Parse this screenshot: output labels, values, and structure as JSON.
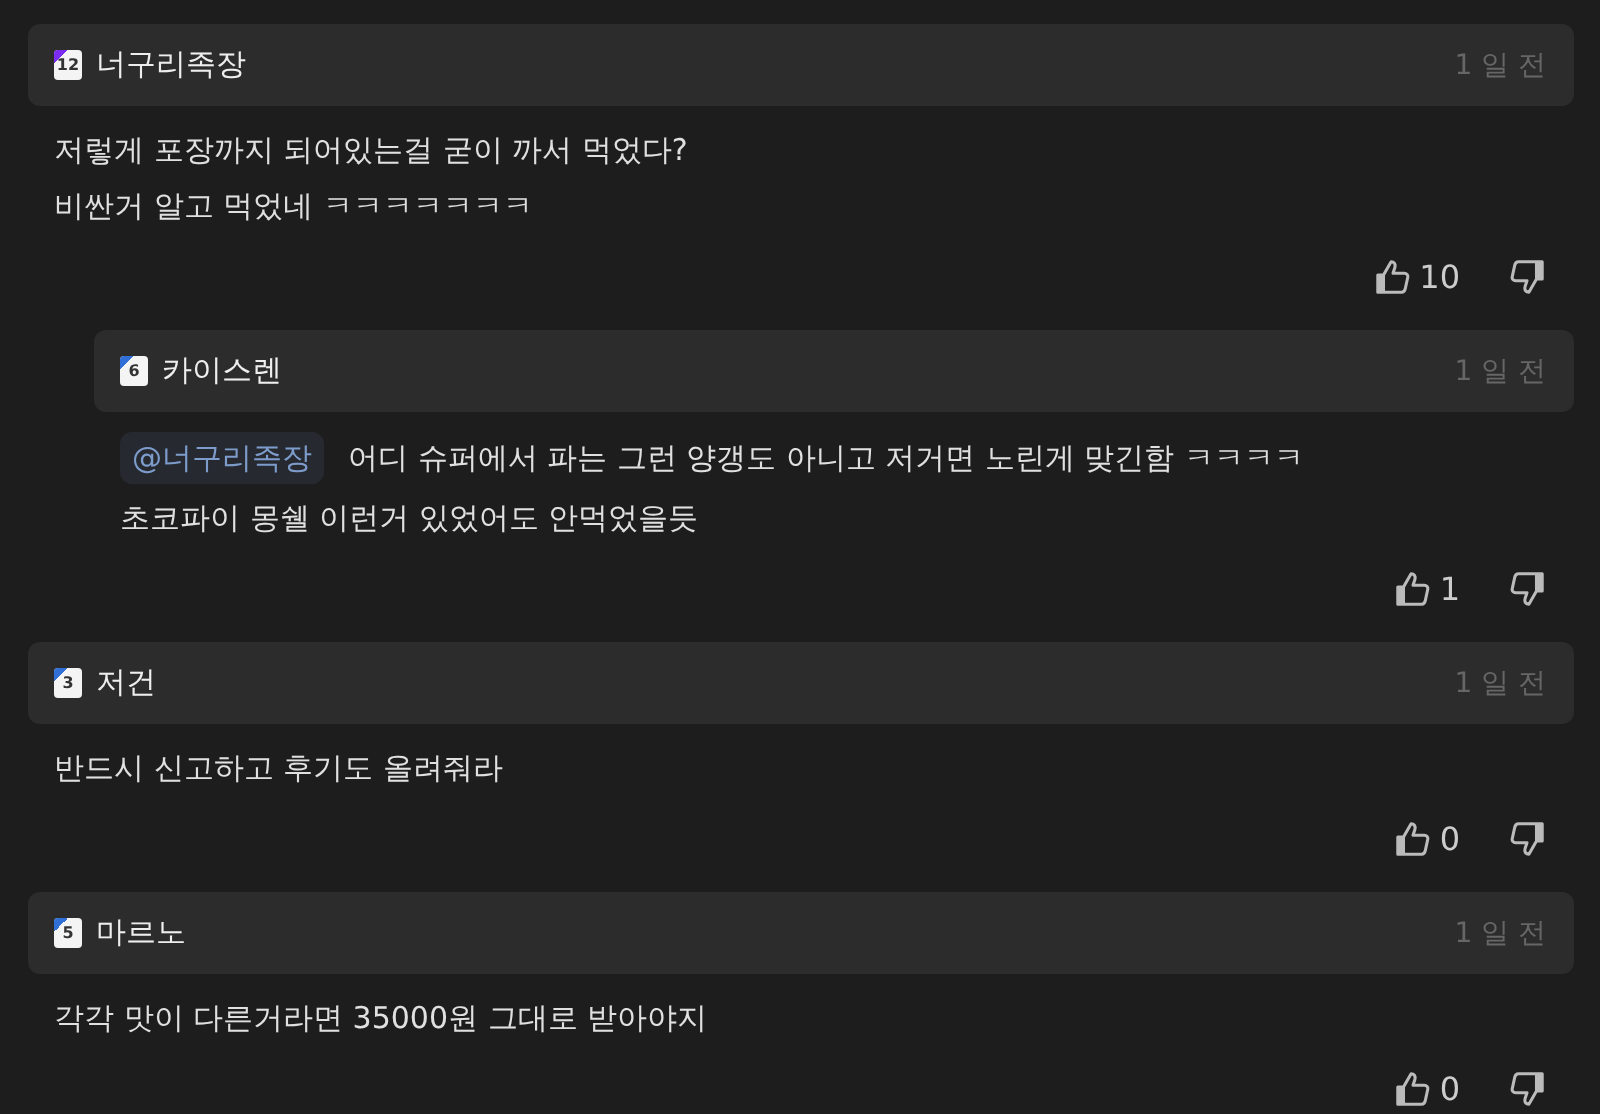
{
  "comments": [
    {
      "author": "너구리족장",
      "badge": "12",
      "color": "#7b2cf0",
      "time": "1 일 전",
      "lines": [
        "저렇게 포장까지 되어있는걸 굳이 까서 먹었다?",
        "비싼거 알고 먹었네 ㅋㅋㅋㅋㅋㅋㅋ"
      ],
      "likes": "10",
      "children": [
        {
          "author": "카이스렌",
          "badge": "6",
          "color": "#2f6fd6",
          "time": "1 일 전",
          "mention": "@너구리족장",
          "lines": [
            "어디 슈퍼에서 파는 그런 양갱도 아니고 저거면 노린게 맞긴함 ㅋㅋㅋㅋ",
            "초코파이 몽쉘 이런거 있었어도 안먹었을듯"
          ],
          "likes": "1"
        }
      ]
    },
    {
      "author": "저건",
      "badge": "3",
      "color": "#2f6fd6",
      "time": "1 일 전",
      "lines": [
        "반드시 신고하고 후기도 올려줘라"
      ],
      "likes": "0"
    },
    {
      "author": "마르노",
      "badge": "5",
      "color": "#2f6fd6",
      "time": "1 일 전",
      "lines": [
        "각각 맛이 다른거라면 35000원 그대로 받아야지"
      ],
      "likes": "0"
    }
  ]
}
